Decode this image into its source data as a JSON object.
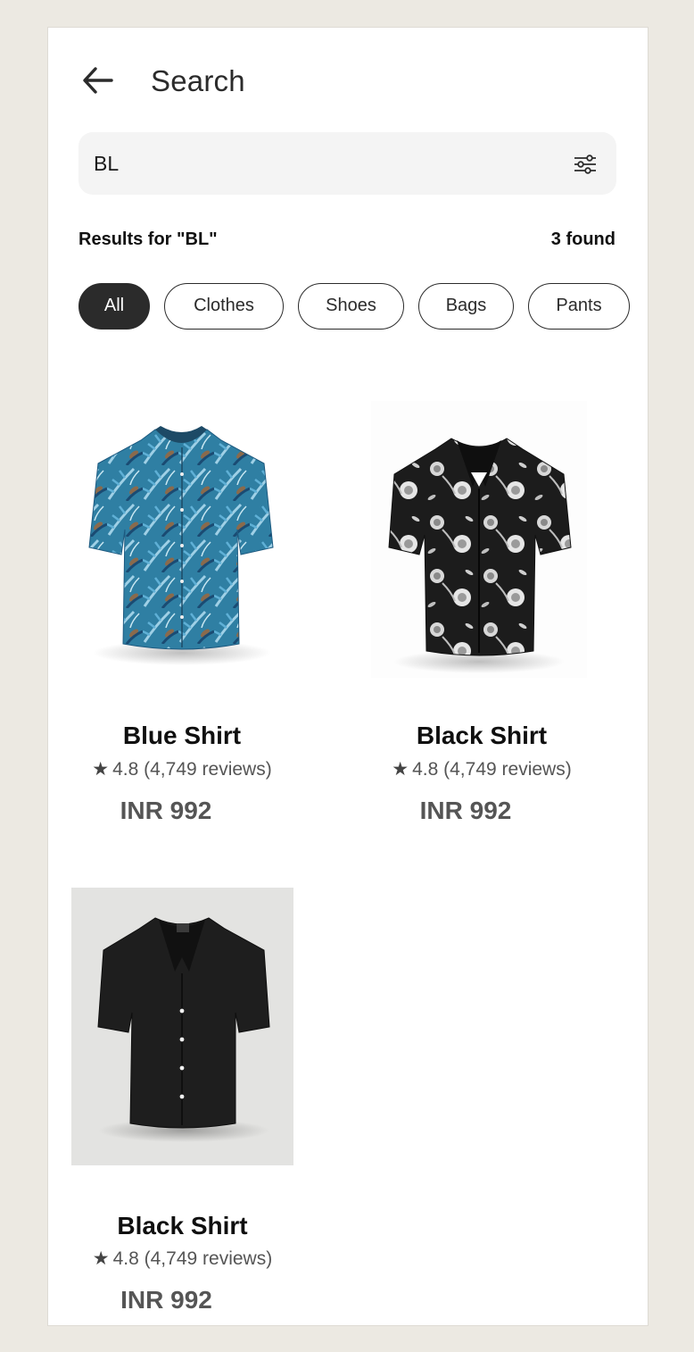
{
  "header": {
    "title": "Search"
  },
  "search": {
    "value": "BL"
  },
  "results": {
    "label": "Results for \"BL\"",
    "count": "3 found"
  },
  "chips": [
    {
      "label": "All",
      "active": true
    },
    {
      "label": "Clothes",
      "active": false
    },
    {
      "label": "Shoes",
      "active": false
    },
    {
      "label": "Bags",
      "active": false
    },
    {
      "label": "Pants",
      "active": false
    }
  ],
  "products": [
    {
      "name": "Blue Shirt",
      "rating": "4.8 (4,749 reviews)",
      "price": "INR 992",
      "image": "blue-tropical-print-shirt"
    },
    {
      "name": "Black Shirt",
      "rating": "4.8 (4,749 reviews)",
      "price": "INR 992",
      "image": "black-floral-print-shirt"
    },
    {
      "name": "Black Shirt",
      "rating": "4.8 (4,749 reviews)",
      "price": "INR 992",
      "image": "solid-black-shirt"
    }
  ],
  "icons": {
    "back": "arrow-left-icon",
    "filter": "sliders-icon",
    "star": "star-icon"
  },
  "colors": {
    "background": "#ece9e2",
    "card": "#ffffff",
    "search_bg": "#f4f4f4",
    "chip_active": "#2b2b2b",
    "price": "#555555"
  }
}
